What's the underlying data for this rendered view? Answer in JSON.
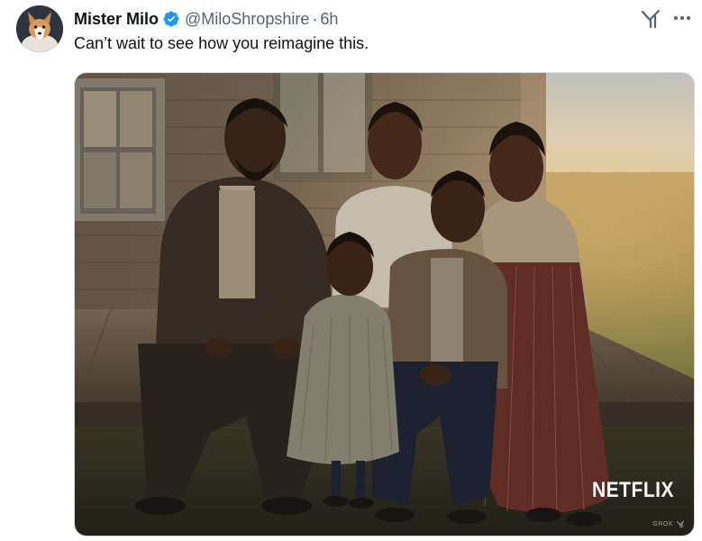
{
  "post": {
    "author": {
      "display_name": "Mister Milo",
      "handle": "@MiloShropshire",
      "separator": "·",
      "time": "6h",
      "verified": true
    },
    "text": "Can’t wait to see how you reimagine this.",
    "media": {
      "overlay_logo": "NETFLIX",
      "watermark": "GROK"
    }
  },
  "actions": {
    "grok_icon": "grok-icon",
    "more_icon": "more-icon"
  },
  "colors": {
    "primary_text": "#0f1419",
    "secondary_text": "#536471",
    "verified_blue": "#1d9bf0",
    "border": "#cfd9de"
  }
}
